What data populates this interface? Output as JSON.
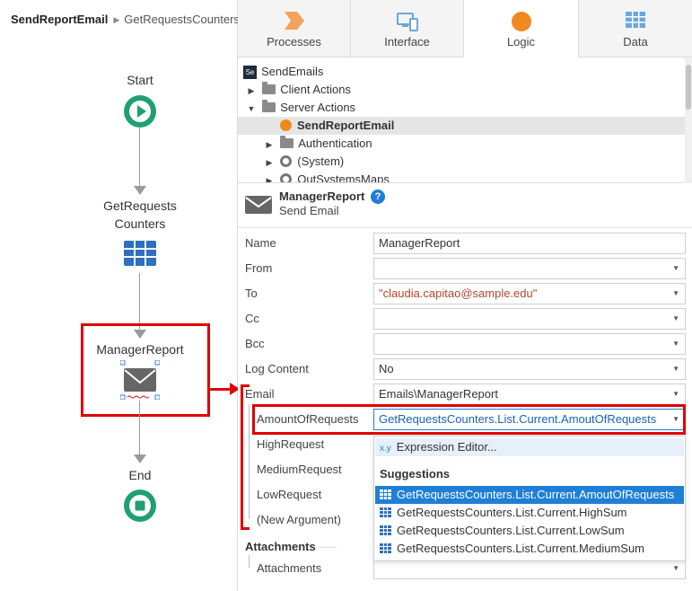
{
  "breadcrumb": {
    "action": "SendReportEmail",
    "current": "GetRequestsCounters"
  },
  "flow": {
    "start": "Start",
    "aggregate_line1": "GetRequests",
    "aggregate_line2": "Counters",
    "email_node": "ManagerReport",
    "end": "End"
  },
  "tabs": [
    {
      "label": "Processes",
      "icon": "processes-icon"
    },
    {
      "label": "Interface",
      "icon": "interface-icon"
    },
    {
      "label": "Logic",
      "icon": "logic-icon",
      "active": true
    },
    {
      "label": "Data",
      "icon": "data-icon"
    }
  ],
  "tree": {
    "root_badge": "Se",
    "root": "SendEmails",
    "items": [
      {
        "label": "Client Actions",
        "expanded": false
      },
      {
        "label": "Server Actions",
        "expanded": true
      },
      {
        "label": "SendReportEmail",
        "selected": true
      },
      {
        "label": "Authentication",
        "expanded": false
      },
      {
        "label": "(System)",
        "expanded": false
      },
      {
        "label": "OutSystemsMaps",
        "expanded": false
      }
    ]
  },
  "props_header": {
    "title": "ManagerReport",
    "subtitle": "Send Email",
    "help": "?"
  },
  "props": {
    "name_label": "Name",
    "name_value": "ManagerReport",
    "from_label": "From",
    "from_value": "",
    "to_label": "To",
    "to_value": "\"claudia.capitao@sample.edu\"",
    "cc_label": "Cc",
    "cc_value": "",
    "bcc_label": "Bcc",
    "bcc_value": "",
    "log_label": "Log Content",
    "log_value": "No",
    "email_label": "Email",
    "email_value": "Emails\\ManagerReport",
    "args": [
      {
        "label": "AmountOfRequests",
        "value": "GetRequestsCounters.List.Current.AmoutOfRequests"
      },
      {
        "label": "HighRequest"
      },
      {
        "label": "MediumRequest"
      },
      {
        "label": "LowRequest"
      },
      {
        "label": "(New Argument)"
      }
    ],
    "attachments_section": "Attachments",
    "attachments_label": "Attachments",
    "attachments_value": ""
  },
  "dropdown": {
    "expr_icon": "x.y",
    "expr_editor": "Expression Editor...",
    "suggestions_heading": "Suggestions",
    "suggestions": [
      "GetRequestsCounters.List.Current.AmoutOfRequests",
      "GetRequestsCounters.List.Current.HighSum",
      "GetRequestsCounters.List.Current.LowSum",
      "GetRequestsCounters.List.Current.MediumSum"
    ],
    "highlighted_index": 0
  },
  "colors": {
    "accent_blue": "#1f7fd6",
    "flow_green": "#20a070",
    "logic_orange": "#f08a1e",
    "highlight_red": "#e00000",
    "tab_icon_blue": "#6aa7dd"
  }
}
